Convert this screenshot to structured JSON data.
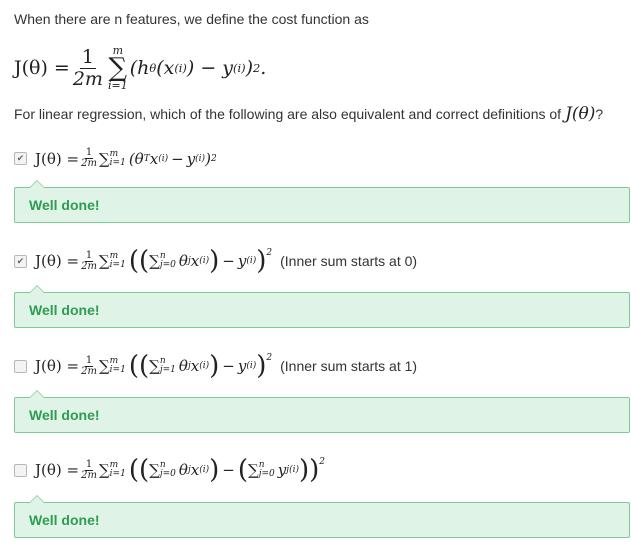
{
  "intro": "When there are n features, we define the cost function as",
  "cost_function": {
    "lhs": "J(θ) =",
    "frac_num": "1",
    "frac_den": "2m",
    "sum_top": "m",
    "sum_bottom": "i=1",
    "body_prefix": "(h",
    "body_sub": "θ",
    "body_mid": "(x",
    "body_sup_i": "(i)",
    "body_minus": ") − y",
    "body_close": ")",
    "square": "2",
    "end": "."
  },
  "question": {
    "text": "For linear regression, which of the following are also equivalent and correct definitions of",
    "math": "J(θ)",
    "end": "?"
  },
  "options": [
    {
      "checked": true,
      "checkmark": "✔",
      "lhs": "J(θ) =",
      "frac_num": "1",
      "frac_den": "2m",
      "sum": "∑",
      "sum_sup": "m",
      "sum_sub": "i=1",
      "body": "(θ",
      "body_sup_T": "T",
      "body_x": "x",
      "sup_i": "(i)",
      "minus": "−",
      "y": "y",
      "close": ")",
      "square": "2",
      "note": "",
      "feedback": "Well done!"
    },
    {
      "checked": true,
      "checkmark": "✔",
      "lhs": "J(θ) =",
      "frac_num": "1",
      "frac_den": "2m",
      "sum": "∑",
      "sum_sup": "m",
      "sum_sub": "i=1",
      "inner_sum_sup": "n",
      "inner_sum_sub": "j=0",
      "inner_term": "θ",
      "inner_sub_j": "j",
      "inner_x": "x",
      "sup_i": "(i)",
      "minus": "−",
      "y": "y",
      "square": "2",
      "note": "(Inner sum starts at 0)",
      "feedback": "Well done!"
    },
    {
      "checked": false,
      "checkmark": "",
      "lhs": "J(θ) =",
      "frac_num": "1",
      "frac_den": "2m",
      "sum": "∑",
      "sum_sup": "m",
      "sum_sub": "i=1",
      "inner_sum_sup": "n",
      "inner_sum_sub": "j=1",
      "inner_term": "θ",
      "inner_sub_j": "j",
      "inner_x": "x",
      "sup_i": "(i)",
      "minus": "−",
      "y": "y",
      "square": "2",
      "note": "(Inner sum starts at 1)",
      "feedback": "Well done!"
    },
    {
      "checked": false,
      "checkmark": "",
      "lhs": "J(θ) =",
      "frac_num": "1",
      "frac_den": "2m",
      "sum": "∑",
      "sum_sup": "m",
      "sum_sub": "i=1",
      "inner_sum_sup": "n",
      "inner_sum_sub": "j=0",
      "inner_term": "θ",
      "inner_sub_j": "j",
      "inner_x": "x",
      "sup_i": "(i)",
      "minus": "−",
      "second_sum_sup": "n",
      "second_sum_sub": "j=0",
      "y": "y",
      "square": "2",
      "note": "",
      "feedback": "Well done!"
    }
  ],
  "colors": {
    "feedback_bg": "#dff4e6",
    "feedback_border": "#7ccc98",
    "feedback_text": "#2e9d52"
  }
}
